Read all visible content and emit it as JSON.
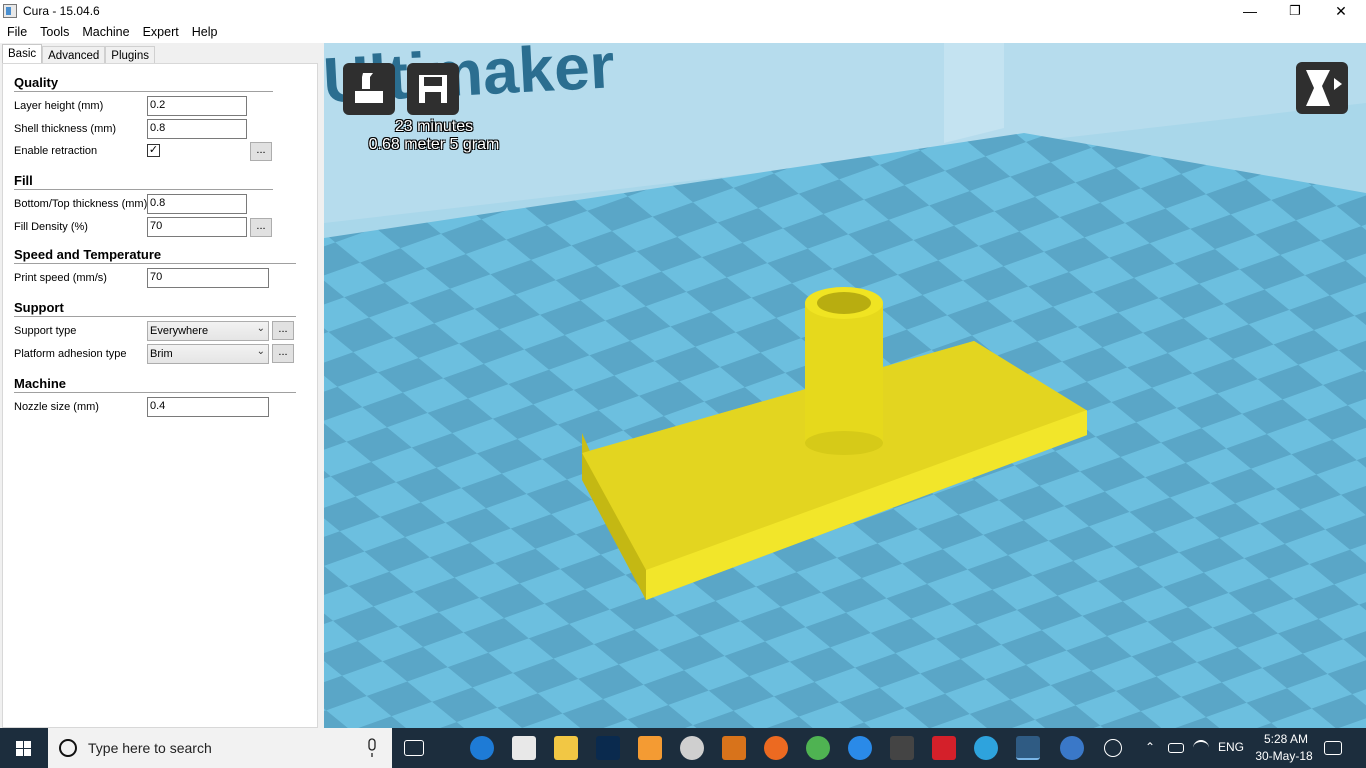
{
  "window": {
    "title": "Cura - 15.04.6",
    "minimize": "—",
    "maximize": "❐",
    "close": "✕"
  },
  "menu": [
    "File",
    "Tools",
    "Machine",
    "Expert",
    "Help"
  ],
  "tabs": [
    "Basic",
    "Advanced",
    "Plugins"
  ],
  "sections": {
    "quality": "Quality",
    "fill": "Fill",
    "speed": "Speed and Temperature",
    "support": "Support",
    "machine": "Machine"
  },
  "fields": {
    "layer_height": {
      "label": "Layer height (mm)",
      "value": "0.2"
    },
    "shell_thickness": {
      "label": "Shell thickness (mm)",
      "value": "0.8"
    },
    "enable_retraction": {
      "label": "Enable retraction",
      "checked": "✓"
    },
    "bottom_top": {
      "label": "Bottom/Top thickness (mm)",
      "value": "0.8"
    },
    "fill_density": {
      "label": "Fill Density (%)",
      "value": "70"
    },
    "print_speed": {
      "label": "Print speed (mm/s)",
      "value": "70"
    },
    "support_type": {
      "label": "Support type",
      "value": "Everywhere"
    },
    "platform_adhesion": {
      "label": "Platform adhesion type",
      "value": "Brim"
    },
    "nozzle_size": {
      "label": "Nozzle size (mm)",
      "value": "0.4"
    }
  },
  "dots": "...",
  "viewport": {
    "brand_text": "Ultimaker",
    "print_time": "23 minutes",
    "print_material": "0.68 meter 5 gram",
    "colors": {
      "floor_light": "#6cbfdf",
      "floor_dark": "#5aa6c7",
      "model": "#f0e422"
    }
  },
  "taskbar": {
    "search_placeholder": "Type here to search",
    "language": "ENG",
    "time": "5:28 AM",
    "date": "30-May-18"
  }
}
